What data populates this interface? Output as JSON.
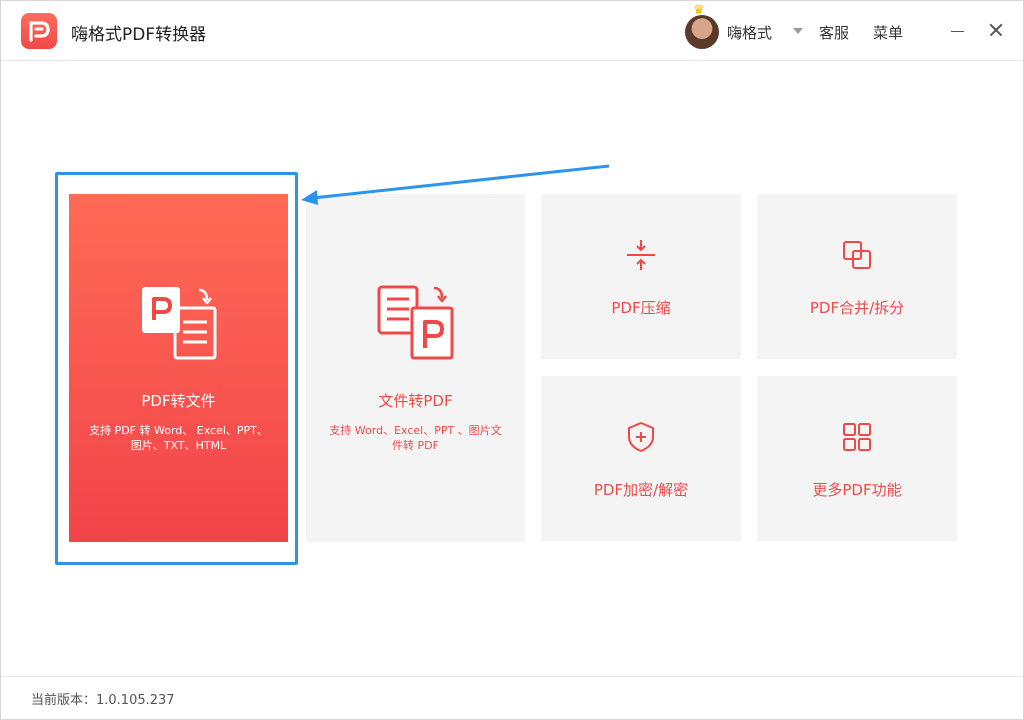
{
  "header": {
    "app_title": "嗨格式PDF转换器",
    "username": "嗨格式",
    "customer_service": "客服",
    "menu": "菜单"
  },
  "tiles": {
    "pdf_to_file": {
      "title": "PDF转文件",
      "desc": "支持 PDF 转 Word、 Excel、PPT、图片、TXT、HTML",
      "icon": "pdf-to-file-icon"
    },
    "file_to_pdf": {
      "title": "文件转PDF",
      "desc": "支持 Word、Excel、PPT 、图片文件转 PDF",
      "icon": "file-to-pdf-icon"
    },
    "compress": {
      "title": "PDF压缩",
      "icon": "compress-icon"
    },
    "merge": {
      "title": "PDF合并/拆分",
      "icon": "merge-split-icon"
    },
    "encrypt": {
      "title": "PDF加密/解密",
      "icon": "shield-icon"
    },
    "more": {
      "title": "更多PDF功能",
      "icon": "grid-icon"
    }
  },
  "footer": {
    "version": "当前版本：1.0.105.237"
  },
  "colors": {
    "accent": "#f04848",
    "selection": "#2c95ea",
    "tile_bg": "#f4f4f4"
  }
}
